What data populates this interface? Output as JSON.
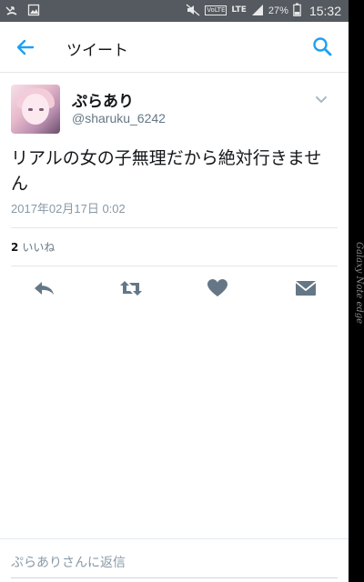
{
  "status_bar": {
    "network": "LTE",
    "volte": "VoLTE",
    "battery": "27%",
    "time": "15:32"
  },
  "app_bar": {
    "title": "ツイート",
    "back_icon": "arrow-left-icon",
    "search_icon": "search-icon"
  },
  "tweet": {
    "display_name": "ぷらあり",
    "handle": "@sharuku_6242",
    "text": "リアルの女の子無理だから絶対行きません",
    "timestamp": "2017年02月17日 0:02",
    "likes_count": "2",
    "likes_label": "いいね"
  },
  "actions": [
    "reply-icon",
    "retweet-icon",
    "heart-icon",
    "message-icon"
  ],
  "reply_box": {
    "placeholder": "ぷらありさんに返信"
  },
  "device_edge_text": "Galaxy Note edge",
  "colors": {
    "accent": "#1da1f2",
    "action_icon": "#657786",
    "status_bar": "#545a60"
  }
}
